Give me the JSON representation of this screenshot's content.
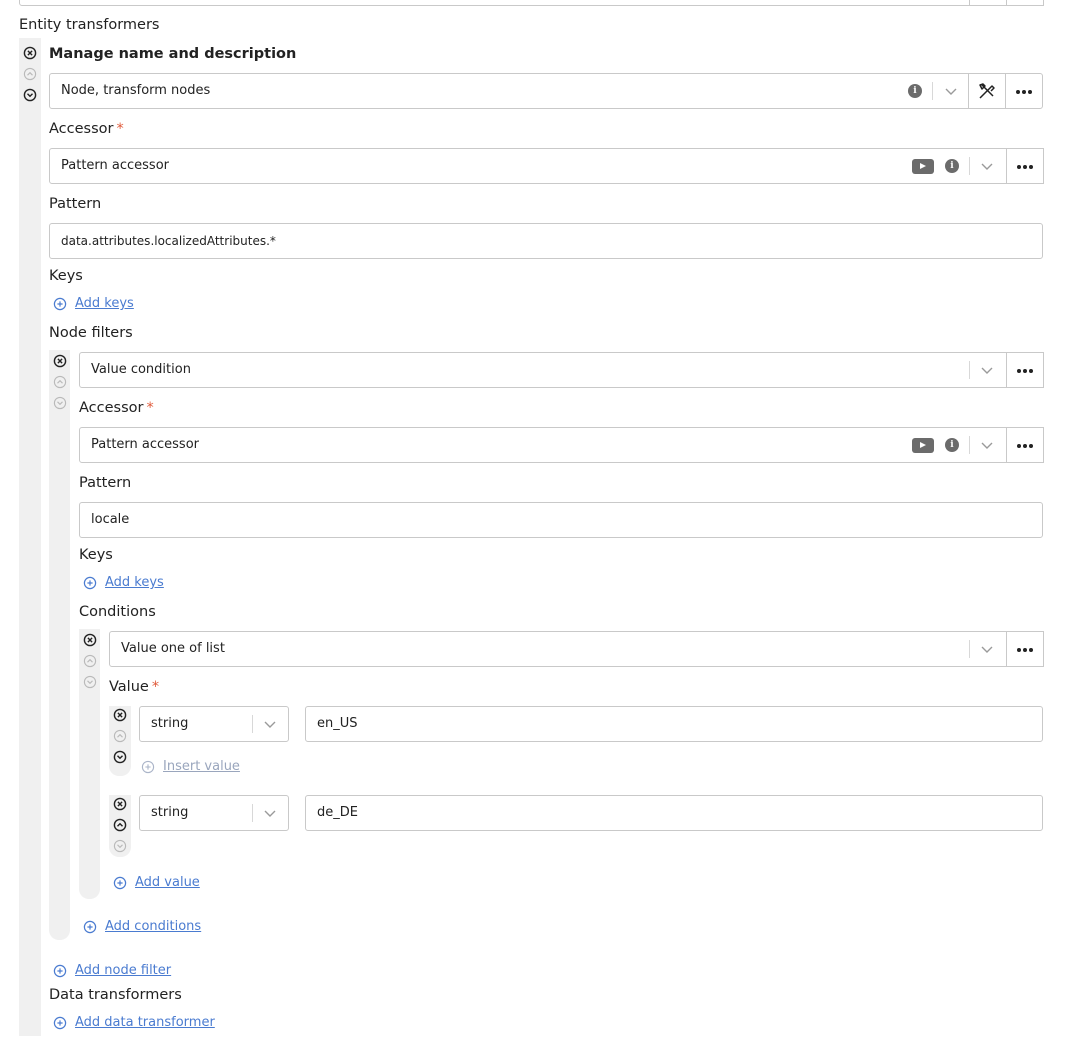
{
  "top_section": {
    "title": "Entity transformers"
  },
  "transformer": {
    "title": "Manage name and description",
    "type_value": "Node, transform nodes",
    "accessor_label": "Accessor",
    "accessor_value": "Pattern accessor",
    "pattern_label": "Pattern",
    "pattern_value": "data.attributes.localizedAttributes.*",
    "keys_label": "Keys",
    "add_keys": "Add keys",
    "node_filters_label": "Node filters",
    "add_node_filter": "Add node filter",
    "data_transformers_label": "Data transformers",
    "add_data_transformer": "Add data transformer"
  },
  "node_filter": {
    "type_value": "Value condition",
    "accessor_label": "Accessor",
    "accessor_value": "Pattern accessor",
    "pattern_label": "Pattern",
    "pattern_value": "locale",
    "keys_label": "Keys",
    "add_keys": "Add keys",
    "conditions_label": "Conditions",
    "add_conditions": "Add conditions"
  },
  "condition": {
    "type_value": "Value one of list",
    "value_label": "Value",
    "values": [
      {
        "type": "string",
        "text": "en_US"
      },
      {
        "type": "string",
        "text": "de_DE"
      }
    ],
    "insert_value": "Insert value",
    "add_value": "Add value"
  },
  "required_marker": "*",
  "colors": {
    "link": "#4a7bd0",
    "required": "#e05a3a",
    "rail": "#f0f0f0",
    "border": "#c9c9c9"
  },
  "icons": [
    "close-circle-icon",
    "arrow-up-circle-icon",
    "arrow-down-circle-icon",
    "info-icon",
    "play-icon",
    "chevron-down-icon",
    "tools-icon",
    "more-options-icon",
    "plus-circle-icon"
  ]
}
